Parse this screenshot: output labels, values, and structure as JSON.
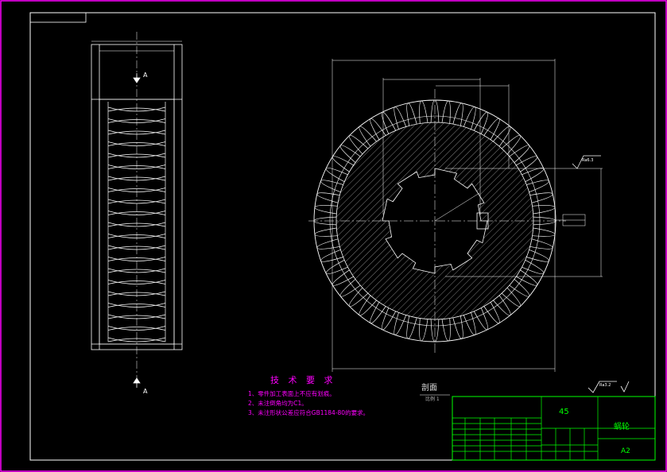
{
  "notes": {
    "title": "技 术 要 求",
    "items": [
      "1、零件加工表面上不应有划痕。",
      "2、未注倒角均为C1。",
      "3、未注形状公差应符合GB1184-80的要求。"
    ]
  },
  "section": {
    "label": "剖面",
    "scale": "比例 1"
  },
  "title_block": {
    "material": "45",
    "part_name": "蜗轮",
    "sheet_size": "A2"
  },
  "section_markers": {
    "top": "A",
    "bottom": "A"
  },
  "roughness": {
    "spec": "Ra6.3",
    "general": "Ra3.2"
  },
  "colors": {
    "border": "#ff00ff",
    "lines": "#ffffff",
    "table": "#00ff00",
    "notes": "#ff00ff",
    "background": "#000000"
  }
}
